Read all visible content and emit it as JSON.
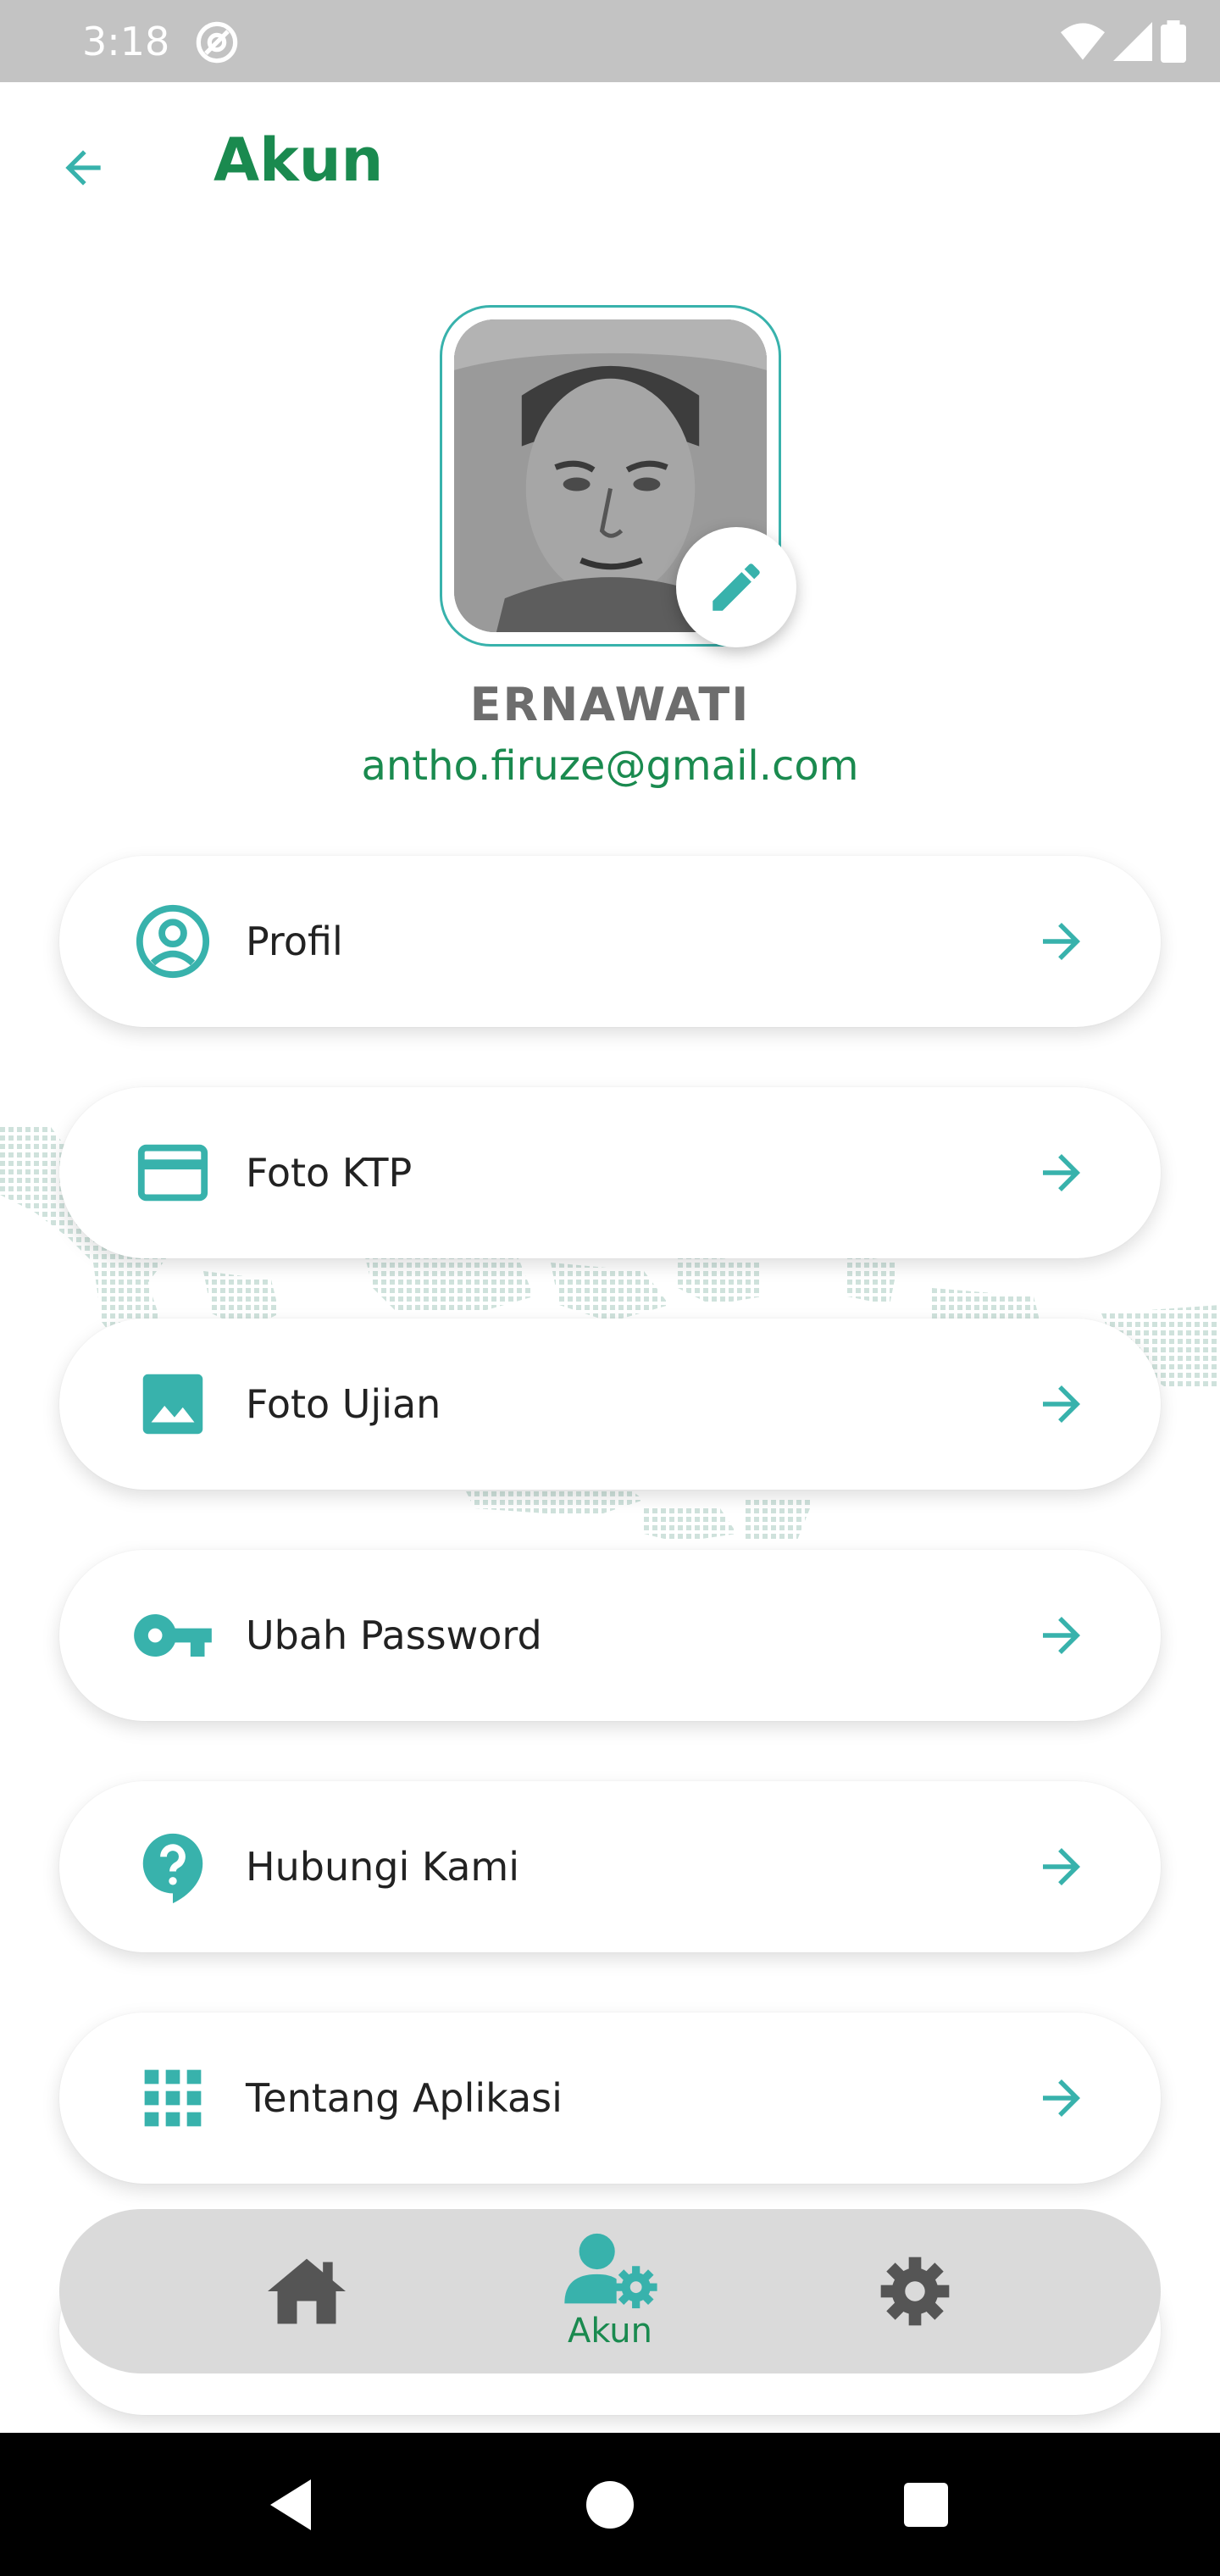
{
  "status_bar": {
    "time": "3:18"
  },
  "app_bar": {
    "title": "Akun"
  },
  "profile": {
    "name": "ERNAWATI",
    "email": "antho.firuze@gmail.com"
  },
  "menu": [
    {
      "label": "Profil",
      "icon": "account-circle-icon"
    },
    {
      "label": "Foto KTP",
      "icon": "credit-card-icon"
    },
    {
      "label": "Foto Ujian",
      "icon": "image-icon"
    },
    {
      "label": "Ubah Password",
      "icon": "key-icon"
    },
    {
      "label": "Hubungi Kami",
      "icon": "help-bubble-icon"
    },
    {
      "label": "Tentang Aplikasi",
      "icon": "apps-grid-icon"
    }
  ],
  "bottom_nav": {
    "active_label": "Akun"
  },
  "colors": {
    "accent": "#38b2ac",
    "title_green": "#1a8a4f",
    "name_gray": "#6d6d6d",
    "nav_bg": "#dadada",
    "nav_icon": "#555555"
  }
}
